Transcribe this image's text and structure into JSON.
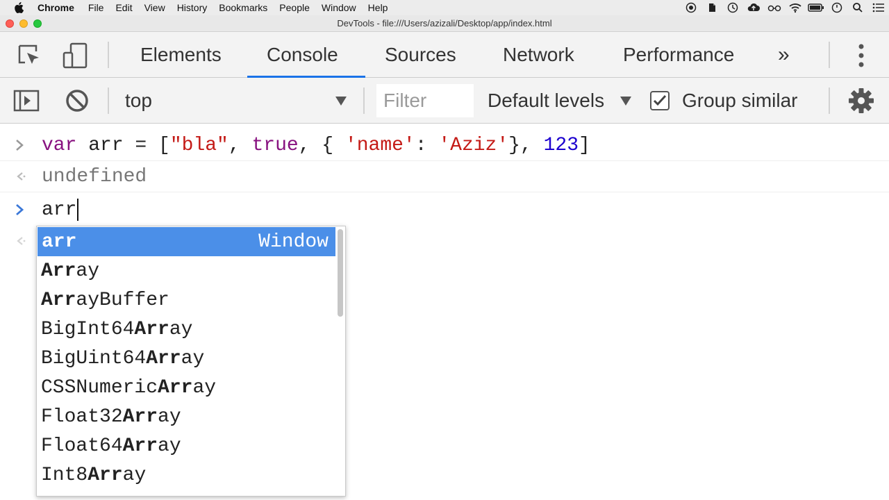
{
  "menubar": {
    "app": "Chrome",
    "items": [
      "File",
      "Edit",
      "View",
      "History",
      "Bookmarks",
      "People",
      "Window",
      "Help"
    ]
  },
  "window": {
    "title": "DevTools - file:///Users/azizali/Desktop/app/index.html"
  },
  "tabs": {
    "items": [
      "Elements",
      "Console",
      "Sources",
      "Network",
      "Performance"
    ],
    "active": "Console",
    "overflow": "»"
  },
  "toolbar": {
    "context": "top",
    "filter_placeholder": "Filter",
    "levels": "Default levels",
    "group_similar": "Group similar",
    "group_similar_checked": true
  },
  "console": {
    "entry1": {
      "input_parts": [
        "var",
        " arr = [",
        "\"bla\"",
        ", ",
        "true",
        ", { ",
        "'name'",
        ": ",
        "'Aziz'",
        "}, ",
        "123",
        "]"
      ],
      "result": "undefined"
    },
    "current_input": "arr"
  },
  "autocomplete": {
    "selected": {
      "label": "arr",
      "type": "Window"
    },
    "items": [
      {
        "bold": "Arr",
        "rest": "ay",
        "prefix": ""
      },
      {
        "bold": "Arr",
        "rest": "ayBuffer",
        "prefix": ""
      },
      {
        "prefix": "BigInt64",
        "bold": "Arr",
        "rest": "ay"
      },
      {
        "prefix": "BigUint64",
        "bold": "Arr",
        "rest": "ay"
      },
      {
        "prefix": "CSSNumeric",
        "bold": "Arr",
        "rest": "ay"
      },
      {
        "prefix": "Float32",
        "bold": "Arr",
        "rest": "ay"
      },
      {
        "prefix": "Float64",
        "bold": "Arr",
        "rest": "ay"
      },
      {
        "prefix": "Int8",
        "bold": "Arr",
        "rest": "ay"
      }
    ]
  },
  "colors": {
    "selection": "#4b8fe8",
    "tab_underline": "#1a73e8",
    "string": "#c41a16",
    "keyword": "#881280",
    "number": "#1c00cf"
  }
}
